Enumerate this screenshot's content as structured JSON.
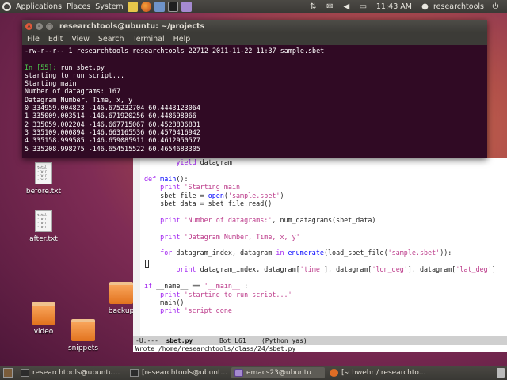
{
  "top_panel": {
    "menus": [
      "Applications",
      "Places",
      "System"
    ],
    "clock": "11:43 AM",
    "user": "researchtools"
  },
  "desktop": {
    "files": [
      {
        "label": "before.txt",
        "preview": "total\n-rw-r\n-rw-r\n-rw-r"
      },
      {
        "label": "after.txt",
        "preview": "total\n-rw-r\n-rw-r\n-rw-r"
      }
    ],
    "folders": [
      {
        "label": "video"
      },
      {
        "label": "snippets"
      },
      {
        "label": "backup"
      }
    ]
  },
  "terminal": {
    "title": "researchtools@ubuntu: ~/projects",
    "menu": [
      "File",
      "Edit",
      "View",
      "Search",
      "Terminal",
      "Help"
    ],
    "lines": [
      "-rw-r--r-- 1 researchtools researchtools 22712 2011-11-22 11:37 sample.sbet",
      "",
      "",
      "starting to run script...",
      "Starting main",
      "Number of datagrams: 167",
      "Datagram Number, Time, x, y",
      "0 334959.004823 -146.675232704 60.4443123064",
      "1 335009.003514 -146.671920256 60.448698066",
      "2 335059.002204 -146.667715067 60.4528836831",
      "3 335109.000894 -146.663165536 60.4570416942",
      "4 335158.999585 -146.659085911 60.4612950577",
      "5 335208.998275 -146.654515522 60.4654683305"
    ],
    "prompt_label": "In [55]:",
    "prompt_cmd": " run sbet.py"
  },
  "emacs": {
    "code": {
      "l1_kw": "yield",
      "l1_rest": " datagram",
      "l3_kw": "def",
      "l3_fn": " main",
      "l3_rest": "():",
      "l4_kw": "print",
      "l4_st": " 'Starting main'",
      "l5_a": "sbet_file = ",
      "l5_fn": "open",
      "l5_b": "(",
      "l5_st": "'sample.sbet'",
      "l5_c": ")",
      "l6": "sbet_data = sbet_file.read()",
      "l8_kw": "print",
      "l8_st": " 'Number of datagrams:'",
      "l8_rest": ", num_datagrams(sbet_data)",
      "l10_kw": "print",
      "l10_st": " 'Datagram Number, Time, x, y'",
      "l12_kw": "for",
      "l12_a": " datagram_index, datagram ",
      "l12_kw2": "in",
      "l12_fn": " enumerate",
      "l12_b": "(load_sbet_file(",
      "l12_st": "'sample.sbet'",
      "l12_c": ")):",
      "l14_kw": "print",
      "l14_a": " datagram_index, datagram[",
      "l14_s1": "'time'",
      "l14_b": "], datagram[",
      "l14_s2": "'lon_deg'",
      "l14_c": "], datagram[",
      "l14_s3": "'lat_deg'",
      "l14_d": "]",
      "l16_kw": "if",
      "l16_a": " __name__ == ",
      "l16_st": "'__main__'",
      "l16_b": ":",
      "l17_kw": "print",
      "l17_st": " 'starting to run script...'",
      "l18": "main()",
      "l19_kw": "print",
      "l19_st": " 'script done!'"
    },
    "modeline": {
      "status": "-U:---  ",
      "buffer": "sbet.py",
      "position": "       Bot L61    ",
      "mode": "(Python yas)"
    },
    "minibuffer": "Wrote /home/researchtools/class/24/sbet.py"
  },
  "taskbar": [
    {
      "label": "researchtools@ubuntu...",
      "icon": "terminal-icon"
    },
    {
      "label": "[researchtools@ubunt...",
      "icon": "terminal-icon"
    },
    {
      "label": "emacs23@ubuntu",
      "icon": "emacs-icon"
    },
    {
      "label": "[schwehr / researchto...",
      "icon": "firefox-icon"
    }
  ]
}
